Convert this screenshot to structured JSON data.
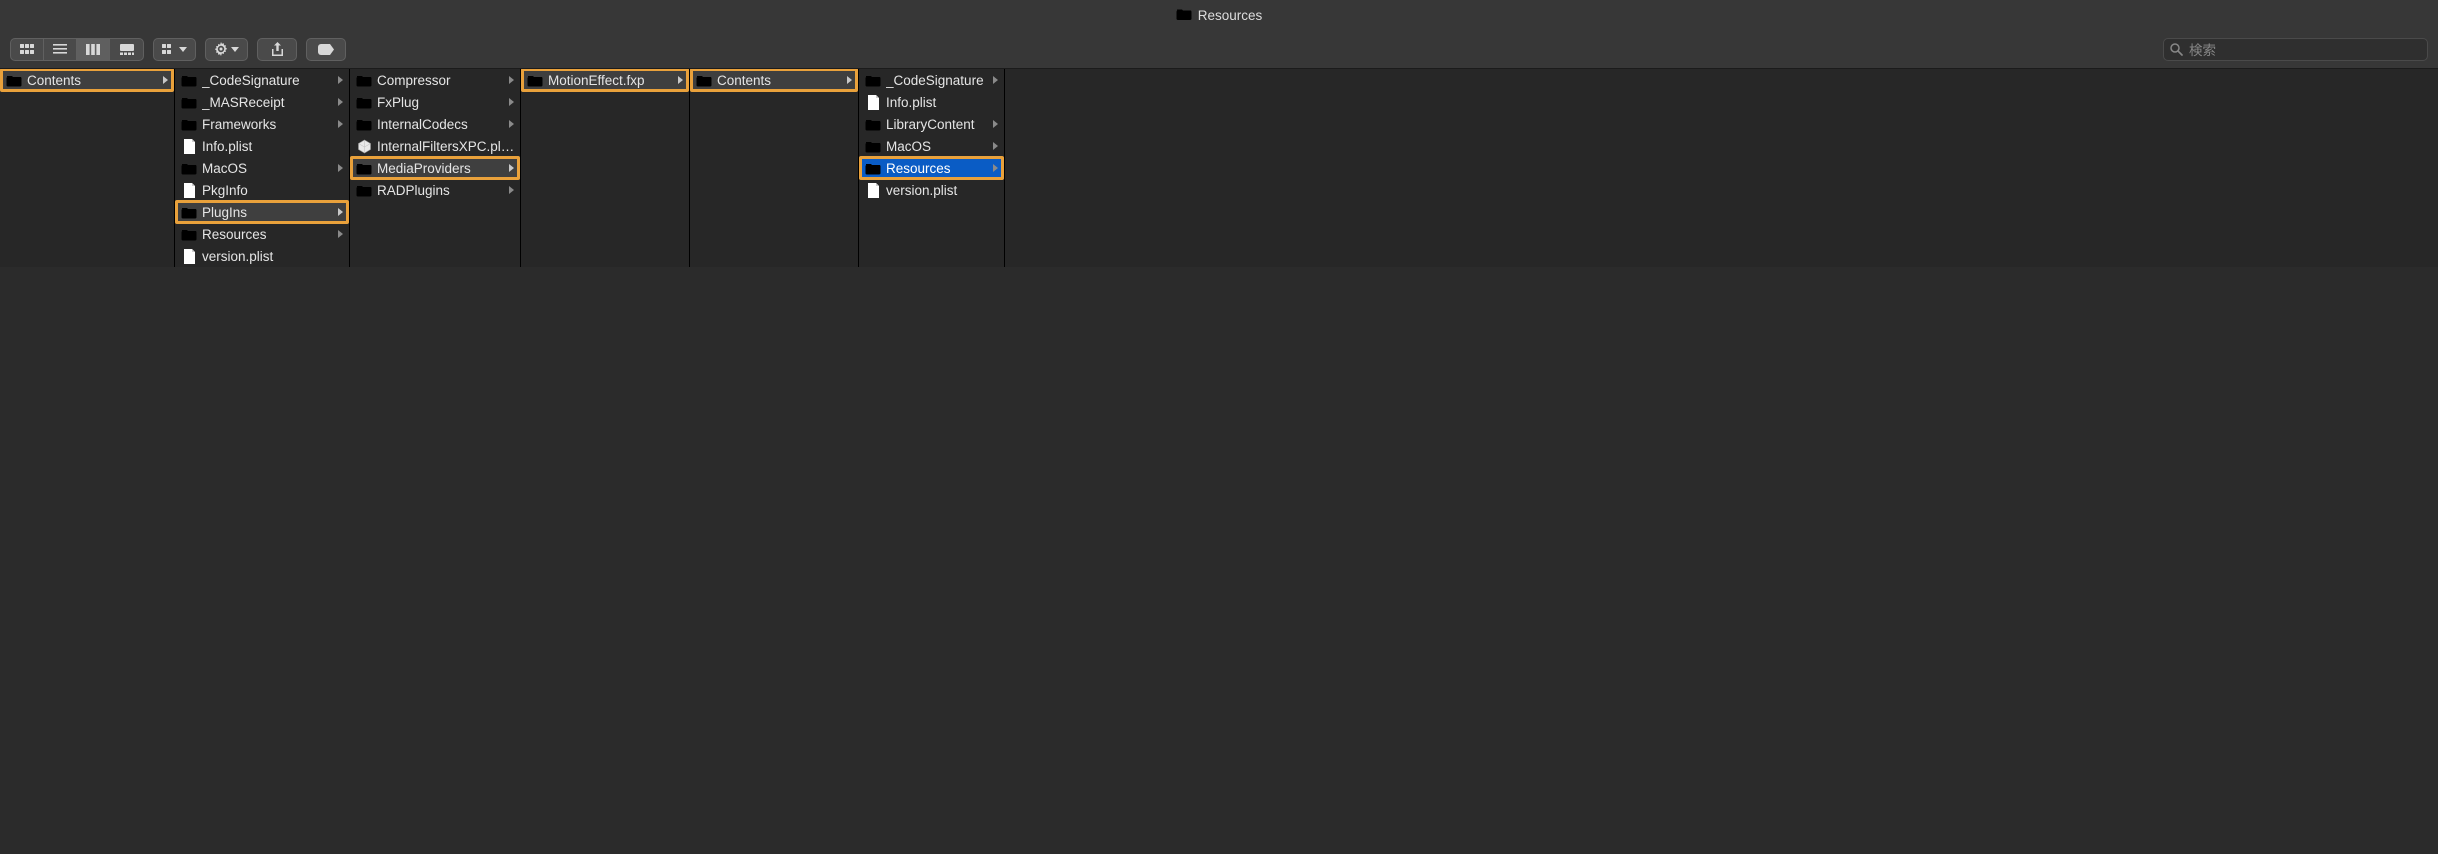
{
  "title": "Resources",
  "search_placeholder": "検索",
  "colors": {
    "highlight": "#e9a13b",
    "selected": "#0a5cc5",
    "folder_light": "#3a97e4",
    "folder_dark": "#2b78c0"
  },
  "columns": [
    {
      "width_class": "col0",
      "items": [
        {
          "name": "Contents",
          "kind": "folder",
          "has_children": true,
          "state": "path",
          "highlighted": true
        }
      ]
    },
    {
      "width_class": "col1",
      "items": [
        {
          "name": "_CodeSignature",
          "kind": "folder",
          "has_children": true,
          "state": "none",
          "highlighted": false
        },
        {
          "name": "_MASReceipt",
          "kind": "folder",
          "has_children": true,
          "state": "none",
          "highlighted": false
        },
        {
          "name": "Frameworks",
          "kind": "folder",
          "has_children": true,
          "state": "none",
          "highlighted": false
        },
        {
          "name": "Info.plist",
          "kind": "file",
          "has_children": false,
          "state": "none",
          "highlighted": false
        },
        {
          "name": "MacOS",
          "kind": "folder",
          "has_children": true,
          "state": "none",
          "highlighted": false
        },
        {
          "name": "PkgInfo",
          "kind": "file",
          "has_children": false,
          "state": "none",
          "highlighted": false
        },
        {
          "name": "PlugIns",
          "kind": "folder",
          "has_children": true,
          "state": "path",
          "highlighted": true
        },
        {
          "name": "Resources",
          "kind": "folder",
          "has_children": true,
          "state": "none",
          "highlighted": false
        },
        {
          "name": "version.plist",
          "kind": "file",
          "has_children": false,
          "state": "none",
          "highlighted": false
        }
      ]
    },
    {
      "width_class": "col2",
      "items": [
        {
          "name": "Compressor",
          "kind": "folder",
          "has_children": true,
          "state": "none",
          "highlighted": false
        },
        {
          "name": "FxPlug",
          "kind": "folder",
          "has_children": true,
          "state": "none",
          "highlighted": false
        },
        {
          "name": "InternalCodecs",
          "kind": "folder",
          "has_children": true,
          "state": "none",
          "highlighted": false
        },
        {
          "name": "InternalFiltersXPC.pluginkit",
          "kind": "plugin",
          "has_children": false,
          "state": "none",
          "highlighted": false
        },
        {
          "name": "MediaProviders",
          "kind": "folder",
          "has_children": true,
          "state": "path",
          "highlighted": true
        },
        {
          "name": "RADPlugins",
          "kind": "folder",
          "has_children": true,
          "state": "none",
          "highlighted": false
        }
      ]
    },
    {
      "width_class": "col3",
      "items": [
        {
          "name": "MotionEffect.fxp",
          "kind": "folder",
          "has_children": true,
          "state": "path",
          "highlighted": true
        }
      ]
    },
    {
      "width_class": "col4",
      "items": [
        {
          "name": "Contents",
          "kind": "folder",
          "has_children": true,
          "state": "path",
          "highlighted": true
        }
      ]
    },
    {
      "width_class": "col5",
      "items": [
        {
          "name": "_CodeSignature",
          "kind": "folder",
          "has_children": true,
          "state": "none",
          "highlighted": false
        },
        {
          "name": "Info.plist",
          "kind": "file",
          "has_children": false,
          "state": "none",
          "highlighted": false
        },
        {
          "name": "LibraryContent",
          "kind": "folder",
          "has_children": true,
          "state": "none",
          "highlighted": false
        },
        {
          "name": "MacOS",
          "kind": "folder",
          "has_children": true,
          "state": "none",
          "highlighted": false
        },
        {
          "name": "Resources",
          "kind": "folder",
          "has_children": true,
          "state": "selected",
          "highlighted": true
        },
        {
          "name": "version.plist",
          "kind": "file",
          "has_children": false,
          "state": "none",
          "highlighted": false
        }
      ]
    }
  ]
}
